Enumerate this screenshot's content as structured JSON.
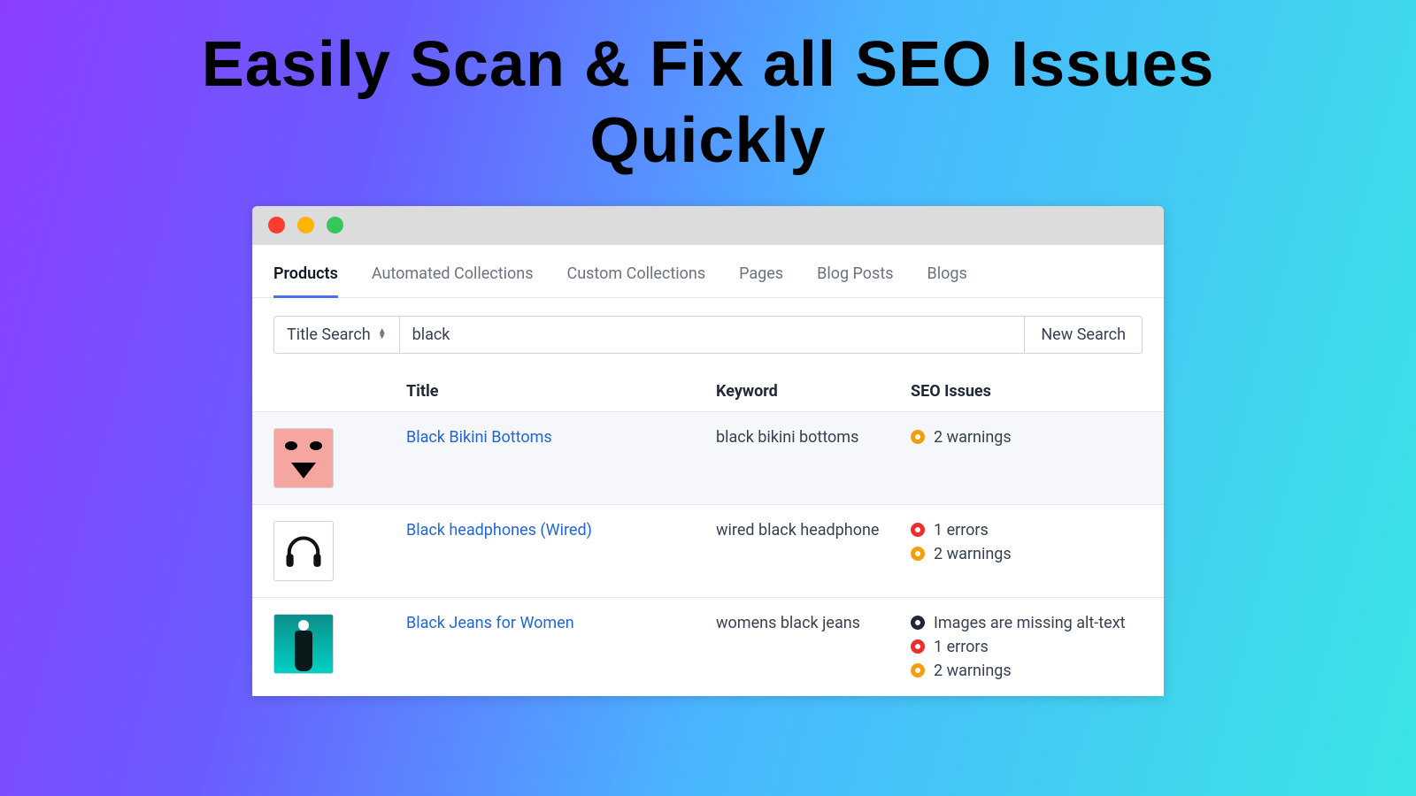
{
  "headline_line1": "Easily Scan & Fix all SEO Issues",
  "headline_line2": "Quickly",
  "tabs": {
    "products": "Products",
    "automated": "Automated Collections",
    "custom": "Custom Collections",
    "pages": "Pages",
    "blogposts": "Blog Posts",
    "blogs": "Blogs"
  },
  "search": {
    "mode_label": "Title Search",
    "query": "black",
    "new_search": "New Search"
  },
  "columns": {
    "title": "Title",
    "keyword": "Keyword",
    "seo": "SEO Issues"
  },
  "rows": [
    {
      "title": "Black Bikini Bottoms",
      "keyword": "black bikini bottoms",
      "issues": [
        {
          "kind": "warn",
          "text": "2 warnings"
        }
      ]
    },
    {
      "title": "Black headphones (Wired)",
      "keyword": "wired black headphone",
      "issues": [
        {
          "kind": "err",
          "text": "1 errors"
        },
        {
          "kind": "warn",
          "text": "2 warnings"
        }
      ]
    },
    {
      "title": "Black Jeans for Women",
      "keyword": "womens black jeans",
      "issues": [
        {
          "kind": "info",
          "text": "Images are missing alt-text"
        },
        {
          "kind": "err",
          "text": "1 errors"
        },
        {
          "kind": "warn",
          "text": "2 warnings"
        }
      ]
    }
  ]
}
